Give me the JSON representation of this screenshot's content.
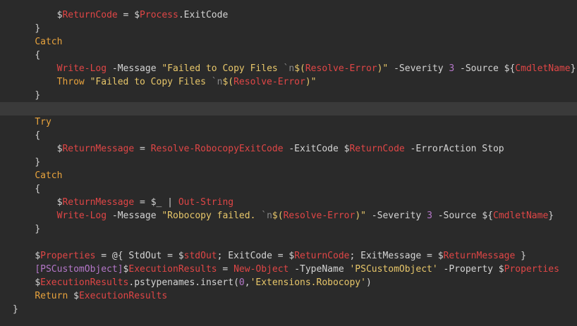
{
  "editor": {
    "colors": {
      "background": "#2a2a2a",
      "current_line": "#3a3a3a",
      "plain": "#d4d4d4",
      "keyword": "#e8a33d",
      "variable": "#e04646",
      "dollar": "#d4d4d4",
      "string": "#e8c76a",
      "number": "#b577c9",
      "type": "#b577c9",
      "cmdlet": "#e04646",
      "escape": "#8a8a8a"
    },
    "current_line_index": 7,
    "lines": [
      {
        "indent": 2,
        "tokens": [
          {
            "t": "$",
            "c": "dollar"
          },
          {
            "t": "ReturnCode",
            "c": "variable"
          },
          {
            "t": " = ",
            "c": "plain"
          },
          {
            "t": "$",
            "c": "dollar"
          },
          {
            "t": "Process",
            "c": "variable"
          },
          {
            "t": ".ExitCode",
            "c": "plain"
          }
        ]
      },
      {
        "indent": 1,
        "tokens": [
          {
            "t": "}",
            "c": "plain"
          }
        ]
      },
      {
        "indent": 1,
        "tokens": [
          {
            "t": "Catch",
            "c": "keyword"
          }
        ]
      },
      {
        "indent": 1,
        "tokens": [
          {
            "t": "{",
            "c": "plain"
          }
        ]
      },
      {
        "indent": 2,
        "tokens": [
          {
            "t": "Write-Log",
            "c": "cmdlet"
          },
          {
            "t": " -Message ",
            "c": "plain"
          },
          {
            "t": "\"Failed to Copy Files ",
            "c": "string"
          },
          {
            "t": "`n",
            "c": "escape"
          },
          {
            "t": "$(",
            "c": "string"
          },
          {
            "t": "Resolve-Error",
            "c": "cmdlet"
          },
          {
            "t": ")\"",
            "c": "string"
          },
          {
            "t": " -Severity ",
            "c": "plain"
          },
          {
            "t": "3",
            "c": "number"
          },
          {
            "t": " -Source ",
            "c": "plain"
          },
          {
            "t": "${",
            "c": "dollar"
          },
          {
            "t": "CmdletName",
            "c": "variable"
          },
          {
            "t": "}",
            "c": "plain"
          }
        ]
      },
      {
        "indent": 2,
        "tokens": [
          {
            "t": "Throw",
            "c": "keyword"
          },
          {
            "t": " ",
            "c": "plain"
          },
          {
            "t": "\"Failed to Copy Files ",
            "c": "string"
          },
          {
            "t": "`n",
            "c": "escape"
          },
          {
            "t": "$(",
            "c": "string"
          },
          {
            "t": "Resolve-Error",
            "c": "cmdlet"
          },
          {
            "t": ")\"",
            "c": "string"
          }
        ]
      },
      {
        "indent": 1,
        "tokens": [
          {
            "t": "}",
            "c": "plain"
          }
        ]
      },
      {
        "indent": 0,
        "tokens": []
      },
      {
        "indent": 1,
        "tokens": [
          {
            "t": "Try",
            "c": "keyword"
          }
        ]
      },
      {
        "indent": 1,
        "tokens": [
          {
            "t": "{",
            "c": "plain"
          }
        ]
      },
      {
        "indent": 2,
        "tokens": [
          {
            "t": "$",
            "c": "dollar"
          },
          {
            "t": "ReturnMessage",
            "c": "variable"
          },
          {
            "t": " = ",
            "c": "plain"
          },
          {
            "t": "Resolve-RobocopyExitCode",
            "c": "cmdlet"
          },
          {
            "t": " -ExitCode ",
            "c": "plain"
          },
          {
            "t": "$",
            "c": "dollar"
          },
          {
            "t": "ReturnCode",
            "c": "variable"
          },
          {
            "t": " -ErrorAction Stop",
            "c": "plain"
          }
        ]
      },
      {
        "indent": 1,
        "tokens": [
          {
            "t": "}",
            "c": "plain"
          }
        ]
      },
      {
        "indent": 1,
        "tokens": [
          {
            "t": "Catch",
            "c": "keyword"
          }
        ]
      },
      {
        "indent": 1,
        "tokens": [
          {
            "t": "{",
            "c": "plain"
          }
        ]
      },
      {
        "indent": 2,
        "tokens": [
          {
            "t": "$",
            "c": "dollar"
          },
          {
            "t": "ReturnMessage",
            "c": "variable"
          },
          {
            "t": " = ",
            "c": "plain"
          },
          {
            "t": "$_",
            "c": "dollar"
          },
          {
            "t": " | ",
            "c": "plain"
          },
          {
            "t": "Out-String",
            "c": "cmdlet"
          }
        ]
      },
      {
        "indent": 2,
        "tokens": [
          {
            "t": "Write-Log",
            "c": "cmdlet"
          },
          {
            "t": " -Message ",
            "c": "plain"
          },
          {
            "t": "\"Robocopy failed. ",
            "c": "string"
          },
          {
            "t": "`n",
            "c": "escape"
          },
          {
            "t": "$(",
            "c": "string"
          },
          {
            "t": "Resolve-Error",
            "c": "cmdlet"
          },
          {
            "t": ")\"",
            "c": "string"
          },
          {
            "t": " -Severity ",
            "c": "plain"
          },
          {
            "t": "3",
            "c": "number"
          },
          {
            "t": " -Source ",
            "c": "plain"
          },
          {
            "t": "${",
            "c": "dollar"
          },
          {
            "t": "CmdletName",
            "c": "variable"
          },
          {
            "t": "}",
            "c": "plain"
          }
        ]
      },
      {
        "indent": 1,
        "tokens": [
          {
            "t": "}",
            "c": "plain"
          }
        ]
      },
      {
        "indent": 0,
        "tokens": []
      },
      {
        "indent": 1,
        "tokens": [
          {
            "t": "$",
            "c": "dollar"
          },
          {
            "t": "Properties",
            "c": "variable"
          },
          {
            "t": " = @{ StdOut = ",
            "c": "plain"
          },
          {
            "t": "$",
            "c": "dollar"
          },
          {
            "t": "stdOut",
            "c": "variable"
          },
          {
            "t": "; ExitCode = ",
            "c": "plain"
          },
          {
            "t": "$",
            "c": "dollar"
          },
          {
            "t": "ReturnCode",
            "c": "variable"
          },
          {
            "t": "; ExitMessage = ",
            "c": "plain"
          },
          {
            "t": "$",
            "c": "dollar"
          },
          {
            "t": "ReturnMessage",
            "c": "variable"
          },
          {
            "t": " }",
            "c": "plain"
          }
        ]
      },
      {
        "indent": 1,
        "tokens": [
          {
            "t": "[PSCustomObject]",
            "c": "type"
          },
          {
            "t": "$",
            "c": "dollar"
          },
          {
            "t": "ExecutionResults",
            "c": "variable"
          },
          {
            "t": " = ",
            "c": "plain"
          },
          {
            "t": "New-Object",
            "c": "cmdlet"
          },
          {
            "t": " -TypeName ",
            "c": "plain"
          },
          {
            "t": "'PSCustomObject'",
            "c": "string"
          },
          {
            "t": " -Property ",
            "c": "plain"
          },
          {
            "t": "$",
            "c": "dollar"
          },
          {
            "t": "Properties",
            "c": "variable"
          }
        ]
      },
      {
        "indent": 1,
        "tokens": [
          {
            "t": "$",
            "c": "dollar"
          },
          {
            "t": "ExecutionResults",
            "c": "variable"
          },
          {
            "t": ".pstypenames.insert(",
            "c": "plain"
          },
          {
            "t": "0",
            "c": "number"
          },
          {
            "t": ",",
            "c": "plain"
          },
          {
            "t": "'Extensions.Robocopy'",
            "c": "string"
          },
          {
            "t": ")",
            "c": "plain"
          }
        ]
      },
      {
        "indent": 1,
        "tokens": [
          {
            "t": "Return",
            "c": "keyword"
          },
          {
            "t": " ",
            "c": "plain"
          },
          {
            "t": "$",
            "c": "dollar"
          },
          {
            "t": "ExecutionResults",
            "c": "variable"
          }
        ]
      },
      {
        "indent": 0,
        "tokens": [
          {
            "t": "}",
            "c": "plain"
          }
        ]
      }
    ]
  }
}
